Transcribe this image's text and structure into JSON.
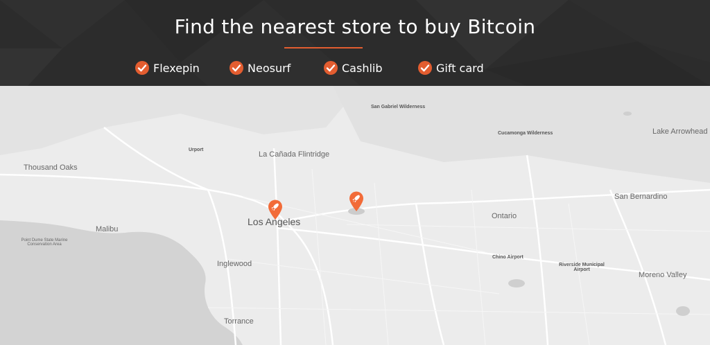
{
  "header": {
    "title": "Find the nearest store to buy Bitcoin",
    "accent_color": "#e35d30",
    "options": [
      {
        "label": "Flexepin",
        "icon": "check-circle-icon"
      },
      {
        "label": "Neosurf",
        "icon": "check-circle-icon"
      },
      {
        "label": "Cashlib",
        "icon": "check-circle-icon"
      },
      {
        "label": "Gift card",
        "icon": "check-circle-icon"
      }
    ]
  },
  "map": {
    "labels": {
      "thousand_oaks": "Thousand Oaks",
      "la_canada": "La Cañada Flintridge",
      "los_angeles": "Los Angeles",
      "malibu": "Malibu",
      "point_dume": "Point Dume State Marine Conservation Area",
      "inglewood": "Inglewood",
      "torrance": "Torrance",
      "ontario": "Ontario",
      "san_bernardino": "San Bernardino",
      "lake_arrowhead": "Lake Arrowhead",
      "moreno_valley": "Moreno Valley",
      "san_gabriel_wilderness": "San Gabriel Wilderness",
      "cucamonga_wilderness": "Cucamonga Wilderness",
      "chino_airport": "Chino Airport",
      "riverside_airport": "Riverside Municipal Airport",
      "urport": "Urport"
    },
    "markers": [
      {
        "name": "store-marker-los-angeles",
        "icon": "rocket-icon"
      },
      {
        "name": "store-marker-east",
        "icon": "rocket-icon"
      }
    ],
    "marker_color": "#f26b38"
  }
}
